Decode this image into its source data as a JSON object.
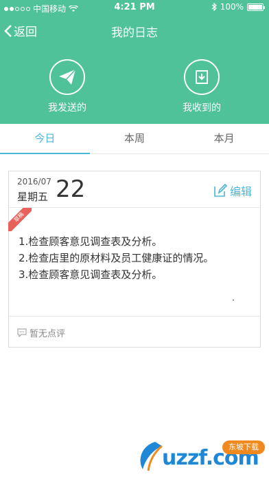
{
  "status_bar": {
    "carrier": "中国移动",
    "time": "4:21 PM",
    "battery_percent": "100%",
    "battery_level": 1.0
  },
  "navbar": {
    "back_label": "返回",
    "title": "我的日志"
  },
  "actions": [
    {
      "label": "我发送的",
      "icon": "paper-plane-icon"
    },
    {
      "label": "我收到的",
      "icon": "inbox-download-icon"
    }
  ],
  "tabs": [
    {
      "label": "今日",
      "active": true
    },
    {
      "label": "本周",
      "active": false
    },
    {
      "label": "本月",
      "active": false
    }
  ],
  "log": {
    "date_small": "2016/07",
    "weekday": "星期五",
    "day": "22",
    "edit_label": "编辑",
    "ribbon_label": "草稿",
    "items": [
      "1.检查顾客意见调查表及分析。",
      "2.检查店里的原材料及员工健康证的情况。",
      "3.检查顾客意见调查表及分析。"
    ],
    "comment_label": "暂无点评"
  },
  "watermark": {
    "text": "uzzf.com",
    "badge": "东坡下载"
  },
  "colors": {
    "header": "#4fc29a",
    "accent": "#4cb6d8",
    "ribbon": "#e8615b"
  }
}
